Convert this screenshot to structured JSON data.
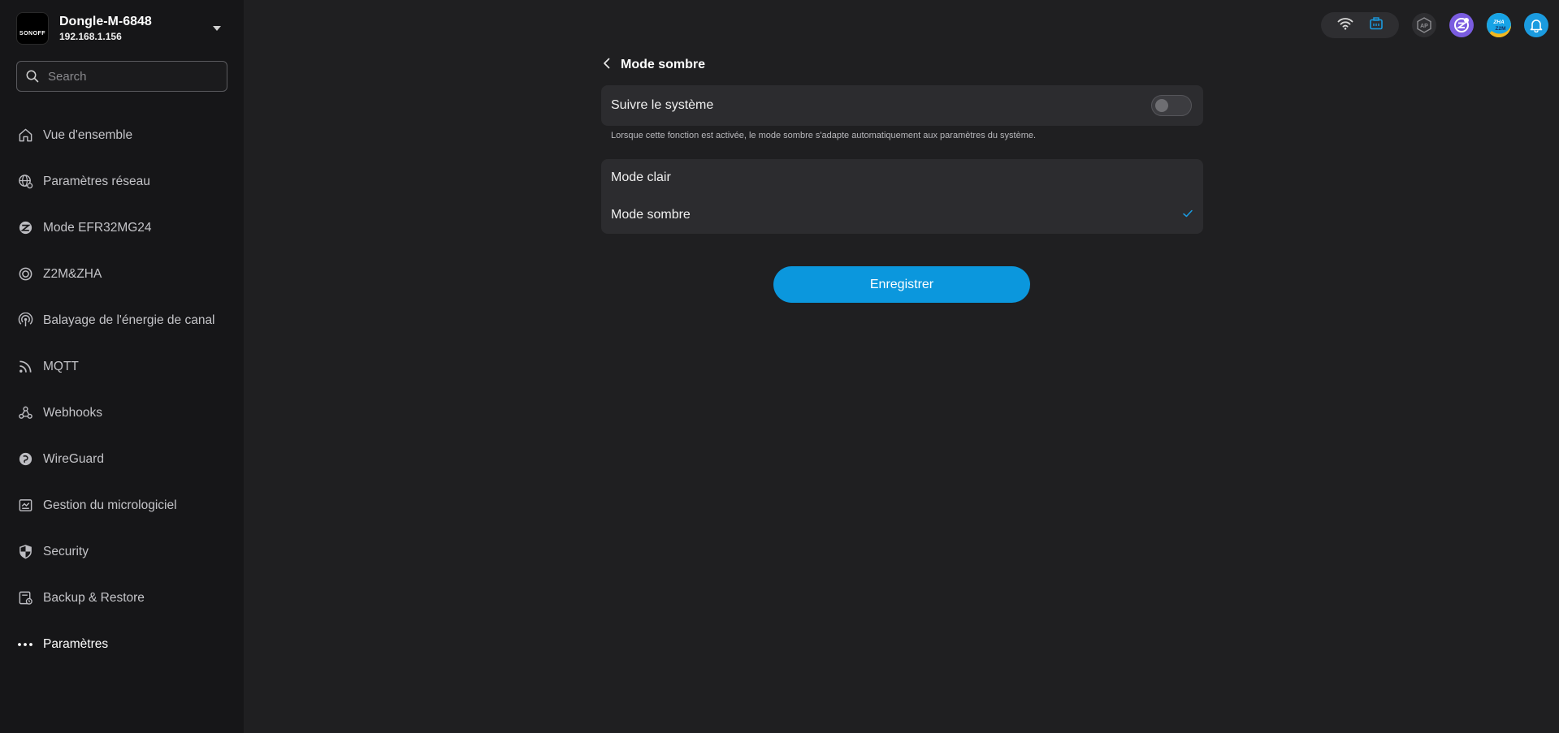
{
  "device": {
    "logo_text": "SONOFF",
    "name": "Dongle-M-6848",
    "ip": "192.168.1.156"
  },
  "search": {
    "placeholder": "Search"
  },
  "sidebar": {
    "items": [
      {
        "label": "Vue d'ensemble",
        "icon": "home-icon"
      },
      {
        "label": "Paramètres réseau",
        "icon": "globe-network-icon"
      },
      {
        "label": "Mode EFR32MG24",
        "icon": "zigbee-icon"
      },
      {
        "label": "Z2M&ZHA",
        "icon": "ring-icon"
      },
      {
        "label": "Balayage de l'énergie de canal",
        "icon": "signal-broadcast-icon"
      },
      {
        "label": "MQTT",
        "icon": "rss-icon"
      },
      {
        "label": "Webhooks",
        "icon": "webhook-icon"
      },
      {
        "label": "WireGuard",
        "icon": "wireguard-icon"
      },
      {
        "label": "Gestion du micrologiciel",
        "icon": "firmware-icon"
      },
      {
        "label": "Security",
        "icon": "shield-icon"
      },
      {
        "label": "Backup & Restore",
        "icon": "backup-icon"
      },
      {
        "label": "Paramètres",
        "icon": "more-dots-icon",
        "active": true
      }
    ]
  },
  "topbar": {
    "ap_label": "AP",
    "zha_label": "ZHA",
    "z2m_label": "Z2M"
  },
  "page": {
    "title": "Mode sombre",
    "follow_system_label": "Suivre le système",
    "follow_system_enabled": false,
    "hint": "Lorsque cette fonction est activée, le mode sombre s'adapte automatiquement aux paramètres du système.",
    "options": [
      {
        "label": "Mode clair",
        "selected": false
      },
      {
        "label": "Mode sombre",
        "selected": true
      }
    ],
    "save_label": "Enregistrer"
  },
  "colors": {
    "accent": "#0b97dd",
    "sidebar_bg": "#161618",
    "main_bg": "#1f1f21",
    "card_bg": "#2c2c2f"
  }
}
